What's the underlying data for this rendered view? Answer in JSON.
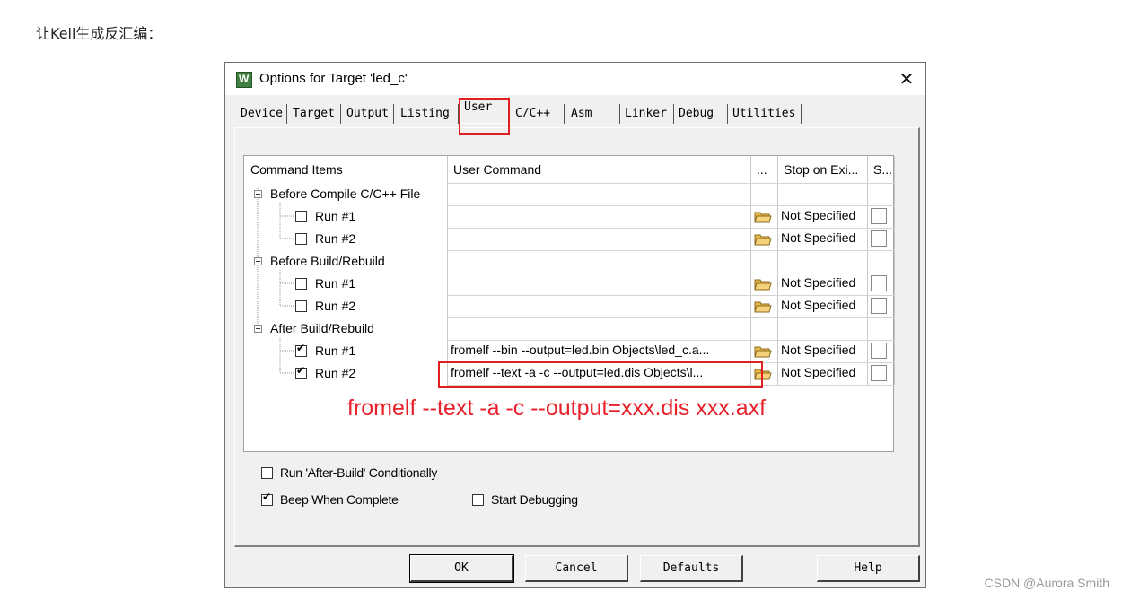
{
  "intro_text": "让Keil生成反汇编：",
  "watermark": "CSDN @Aurora Smith",
  "dialog": {
    "title": "Options for Target 'led_c'",
    "close_glyph": "✕",
    "tabs": [
      "Device",
      "Target",
      "Output",
      "Listing",
      "User",
      "C/C++",
      "Asm",
      "Linker",
      "Debug",
      "Utilities"
    ],
    "active_tab": "User",
    "grid_headers": {
      "command_items": "Command Items",
      "user_command": "User Command",
      "browse": "...",
      "stop_on_exit": "Stop on Exi...",
      "s": "S..."
    },
    "groups": [
      {
        "label": "Before Compile C/C++ File",
        "runs": [
          {
            "label": "Run #1",
            "checked": false,
            "command": "",
            "stop": "Not Specified"
          },
          {
            "label": "Run #2",
            "checked": false,
            "command": "",
            "stop": "Not Specified"
          }
        ]
      },
      {
        "label": "Before Build/Rebuild",
        "runs": [
          {
            "label": "Run #1",
            "checked": false,
            "command": "",
            "stop": "Not Specified"
          },
          {
            "label": "Run #2",
            "checked": false,
            "command": "",
            "stop": "Not Specified"
          }
        ]
      },
      {
        "label": "After Build/Rebuild",
        "runs": [
          {
            "label": "Run #1",
            "checked": true,
            "command": "fromelf --bin --output=led.bin Objects\\led_c.a...",
            "stop": "Not Specified"
          },
          {
            "label": "Run #2",
            "checked": true,
            "command": "fromelf --text -a -c --output=led.dis Objects\\l...",
            "stop": "Not Specified"
          }
        ]
      }
    ],
    "annotation": "fromelf  --text  -a -c  --output=xxx.dis  xxx.axf",
    "options": {
      "run_after_build": "Run 'After-Build' Conditionally",
      "run_after_build_checked": false,
      "beep": "Beep When Complete",
      "beep_checked": true,
      "start_debugging": "Start Debugging",
      "start_debugging_checked": false
    },
    "buttons": {
      "ok": "OK",
      "cancel": "Cancel",
      "defaults": "Defaults",
      "help": "Help"
    }
  },
  "colors": {
    "highlight_red": "#e02020",
    "annotation_red": "#e8202a"
  }
}
